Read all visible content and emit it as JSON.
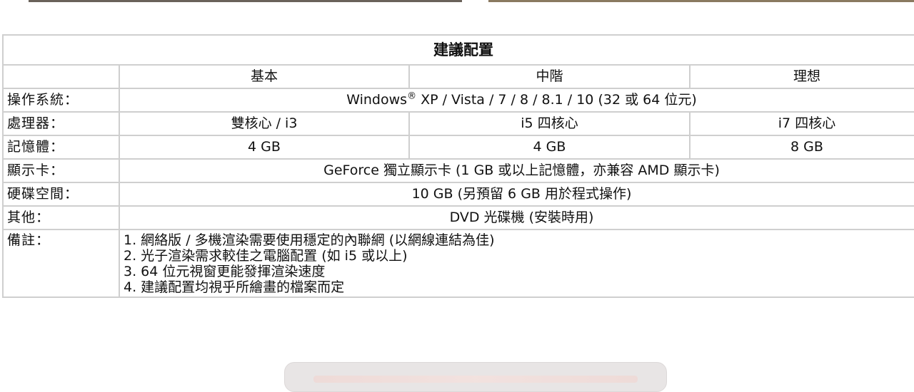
{
  "table": {
    "title": "建議配置",
    "headers": [
      "基本",
      "中階",
      "理想"
    ],
    "rows": {
      "os": {
        "label": "操作系統：",
        "value_pre": "Windows",
        "value_sup": "®",
        "value_post": " XP / Vista / 7 / 8 / 8.1 / 10 (32 或 64 位元)"
      },
      "cpu": {
        "label": "處理器：",
        "basic": "雙核心 / i3",
        "mid": "i5 四核心",
        "ideal": "i7 四核心"
      },
      "ram": {
        "label": "記憶體：",
        "basic": "4 GB",
        "mid": "4 GB",
        "ideal": "8 GB"
      },
      "gpu": {
        "label": "顯示卡：",
        "value": "GeForce 獨立顯示卡 (1 GB 或以上記憶體，亦兼容 AMD 顯示卡)"
      },
      "disk": {
        "label": "硬碟空間：",
        "value": "10 GB (另預留 6 GB 用於程式操作)"
      },
      "other": {
        "label": "其他：",
        "value": "DVD 光碟機 (安裝時用)"
      },
      "notes": {
        "label": "備註：",
        "lines": [
          "1. 網絡版 / 多機渲染需要使用穩定的內聯網 (以網線連結為佳)",
          "2. 光子渲染需求較佳之電腦配置 (如 i5 或以上)",
          "3. 64 位元視窗更能發揮渲染速度",
          "4. 建議配置均視乎所繪畫的檔案而定"
        ]
      }
    }
  }
}
